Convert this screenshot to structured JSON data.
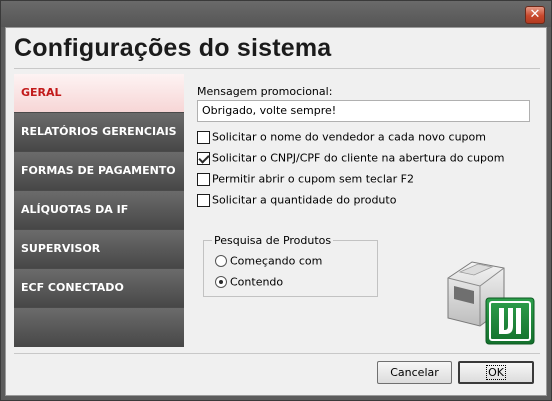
{
  "window": {
    "close_glyph": "✕"
  },
  "header": {
    "title": "Configurações do sistema"
  },
  "sidebar": {
    "items": [
      {
        "label": "GERAL",
        "active": true
      },
      {
        "label": "RELATÓRIOS GERENCIAIS",
        "active": false
      },
      {
        "label": "FORMAS DE PAGAMENTO",
        "active": false
      },
      {
        "label": "ALÍQUOTAS DA IF",
        "active": false
      },
      {
        "label": "SUPERVISOR",
        "active": false
      },
      {
        "label": "ECF CONECTADO",
        "active": false
      }
    ]
  },
  "general": {
    "promo_label": "Mensagem promocional:",
    "promo_value": "Obrigado, volte sempre!",
    "checkboxes": [
      {
        "label": "Solicitar o nome do vendedor a cada novo cupom",
        "checked": false
      },
      {
        "label": "Solicitar o CNPJ/CPF do cliente na abertura do cupom",
        "checked": true
      },
      {
        "label": "Permitir abrir o cupom sem teclar F2",
        "checked": false
      },
      {
        "label": "Solicitar a quantidade do produto",
        "checked": false
      }
    ],
    "search_group": {
      "title": "Pesquisa de Produtos",
      "options": [
        {
          "label": "Começando com",
          "selected": false
        },
        {
          "label": "Contendo",
          "selected": true
        }
      ]
    }
  },
  "logo": {
    "icon": "printer-logo-icon",
    "brand_color": "#1e8a3a"
  },
  "buttons": {
    "cancel": "Cancelar",
    "ok": "OK"
  }
}
